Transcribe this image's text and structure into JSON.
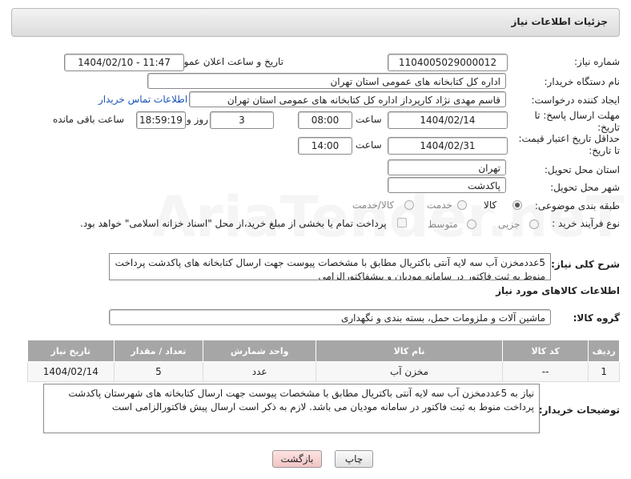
{
  "header": {
    "title": "جزئیات اطلاعات نیاز"
  },
  "fields": {
    "need_number_label": "شماره نیاز:",
    "need_number": "1104005029000012",
    "announce_label": "تاریخ و ساعت اعلان عمومی:",
    "announce_value": "1404/02/10 - 11:47",
    "buyer_org_label": "نام دستگاه خریدار:",
    "buyer_org": "اداره کل کتابخانه های عمومی استان تهران",
    "creator_label": "ایجاد کننده درخواست:",
    "creator": "قاسم مهدی نژاد کارپرداز اداره کل کتابخانه های عمومی استان تهران",
    "contact_link": "اطلاعات تماس خریدار",
    "deadline_label_1": "مهلت ارسال پاسخ: تا",
    "deadline_label_2": "تاریخ:",
    "deadline_date": "1404/02/14",
    "time_label": "ساعت",
    "deadline_time": "08:00",
    "days_value": "3",
    "days_label": "روز و",
    "remaining_time": "18:59:19",
    "remaining_label": "ساعت باقی مانده",
    "validity_label_1": "حداقل تاریخ اعتبار قیمت:",
    "validity_label_2": "تا تاریخ:",
    "validity_date": "1404/02/31",
    "validity_time": "14:00",
    "province_label": "استان محل تحویل:",
    "province": "تهران",
    "city_label": "شهر محل تحویل:",
    "city": "پاکدشت",
    "category_label": "طبقه بندی موضوعی:",
    "category_options": [
      "کالا",
      "خدمت",
      "کالا/خدمت"
    ],
    "process_label": "نوع فرآیند خرید :",
    "process_options": [
      "جزیی",
      "متوسط"
    ],
    "payment_note": "پرداخت تمام یا بخشی از مبلغ خرید،از محل \"اسناد خزانه اسلامی\" خواهد بود."
  },
  "summary": {
    "label": "شرح کلی نیاز:",
    "text": "5عددمخزن آب سه لایه آنتی باکتریال مطابق با مشخصات پیوست جهت ارسال کتابخانه های پاکدشت پرداخت منوط به ثبت فاکتور در سامانه مودیان و پیشفاکتورالزامی"
  },
  "goods": {
    "section_title": "اطلاعات کالاهای مورد نیاز",
    "group_label": "گروه کالا:",
    "group_value": "ماشین آلات و ملزومات حمل، بسته بندی و نگهداری",
    "columns": [
      "ردیف",
      "کد کالا",
      "نام کالا",
      "واحد شمارش",
      "تعداد / مقدار",
      "تاریخ نیاز"
    ],
    "rows": [
      [
        "1",
        "--",
        "مخزن آب",
        "عدد",
        "5",
        "1404/02/14"
      ]
    ]
  },
  "buyer_notes": {
    "label": "توضیحات خریدار:",
    "text": "نیاز به 5عددمخزن آب سه لایه آنتی باکتریال مطابق با مشخصات پیوست جهت ارسال کتابخانه های شهرستان پاکدشت پرداخت منوط به ثبت فاکتور در سامانه مودیان می باشد. لازم به ذکر است ارسال پیش فاکتورالزامی است"
  },
  "buttons": {
    "print": "چاپ",
    "back": "بازگشت"
  },
  "watermark": "AriaTender.neT"
}
